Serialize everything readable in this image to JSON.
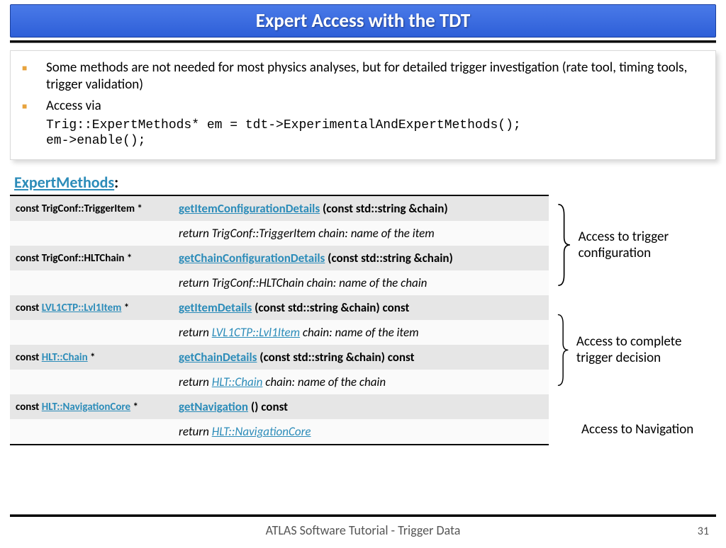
{
  "title": "Expert Access with the TDT",
  "bullets": [
    {
      "text": "Some methods are not needed for most physics analyses, but for detailed trigger investigation (rate tool, timing tools, trigger validation)"
    },
    {
      "text": "Access via"
    }
  ],
  "code_lines": [
    "Trig::ExpertMethods* em = tdt->ExperimentalAndExpertMethods();",
    "em->enable();"
  ],
  "section_heading_link": "ExpertMethods",
  "section_heading_suffix": ":",
  "methods": [
    {
      "type_prefix": "const TrigConf::TriggerItem *",
      "type_link": "",
      "type_suffix": "",
      "name": "getItemConfigurationDetails",
      "sig": " (const std::string &chain)",
      "desc_prefix": "return TrigConf::TriggerItem chain: name of the item",
      "desc_link": "",
      "desc_suffix": ""
    },
    {
      "type_prefix": "const TrigConf::HLTChain *",
      "type_link": "",
      "type_suffix": "",
      "name": "getChainConfigurationDetails",
      "sig": " (const std::string &chain)",
      "desc_prefix": "return TrigConf::HLTChain chain: name of the chain",
      "desc_link": "",
      "desc_suffix": ""
    },
    {
      "type_prefix": "const ",
      "type_link": "LVL1CTP::Lvl1Item",
      "type_suffix": " *",
      "name": "getItemDetails",
      "sig": " (const std::string &chain) const",
      "desc_prefix": "return ",
      "desc_link": "LVL1CTP::Lvl1Item",
      "desc_suffix": " chain: name of the item"
    },
    {
      "type_prefix": "const ",
      "type_link": "HLT::Chain",
      "type_suffix": " *",
      "name": "getChainDetails",
      "sig": " (const std::string &chain) const",
      "desc_prefix": "return ",
      "desc_link": "HLT::Chain",
      "desc_suffix": " chain: name of the chain"
    },
    {
      "type_prefix": "const ",
      "type_link": "HLT::NavigationCore",
      "type_suffix": " *",
      "name": "getNavigation",
      "sig": " () const",
      "desc_prefix": "return ",
      "desc_link": "HLT::NavigationCore",
      "desc_suffix": ""
    }
  ],
  "side_labels": [
    "Access to trigger configuration",
    "Access to complete trigger decision",
    "Access to Navigation"
  ],
  "footer": "ATLAS Software Tutorial - Trigger Data",
  "page": "31"
}
